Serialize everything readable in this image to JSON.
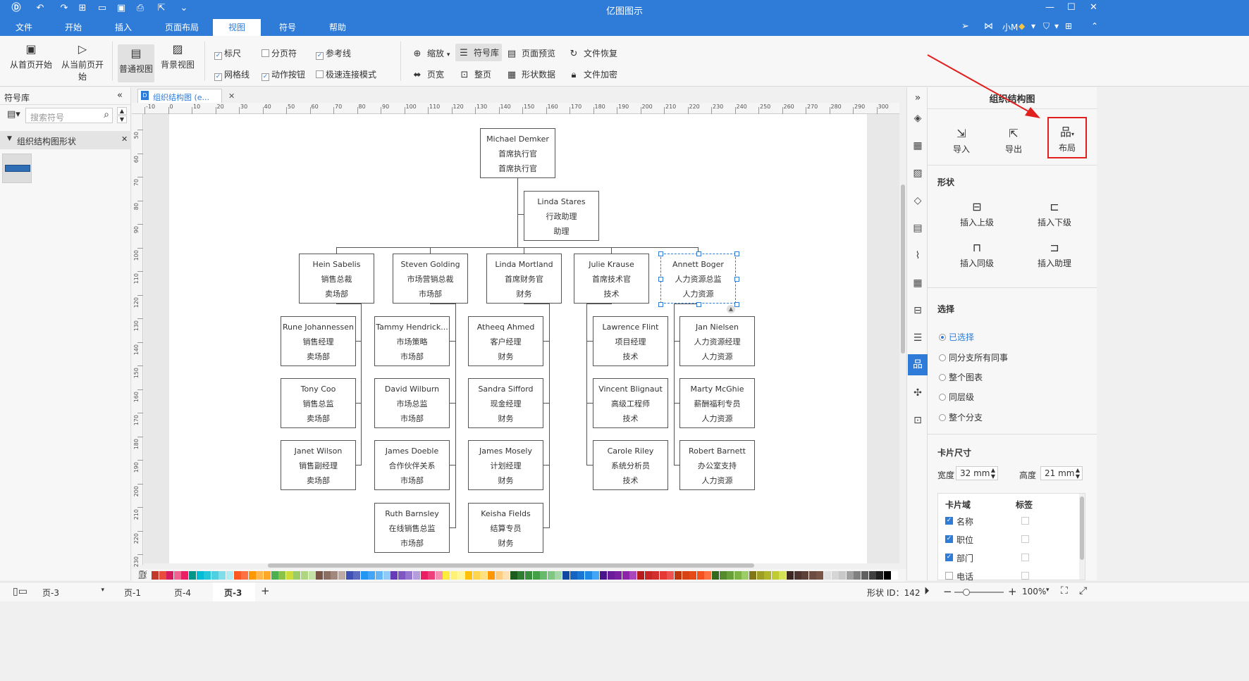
{
  "titlebar": {
    "title": "亿图图示",
    "user": "小M",
    "quick_icons": [
      "logo-icon",
      "undo-icon",
      "redo-icon",
      "new-icon",
      "open-icon",
      "save-icon",
      "print-icon",
      "export-icon",
      "more-icon"
    ]
  },
  "menu": [
    "文件",
    "开始",
    "插入",
    "页面布局",
    "视图",
    "符号",
    "帮助"
  ],
  "menu_active": "视图",
  "ribbon": {
    "big": [
      "从首页开始",
      "从当前页开始",
      "普通视图",
      "背景视图"
    ],
    "checks": [
      {
        "label": "标尺",
        "checked": true
      },
      {
        "label": "分页符",
        "checked": false
      },
      {
        "label": "参考线",
        "checked": true
      },
      {
        "label": "网格线",
        "checked": true
      },
      {
        "label": "动作按钮",
        "checked": true
      },
      {
        "label": "极速连接模式",
        "checked": false
      }
    ],
    "small": [
      "缩放",
      "符号库",
      "页面预览",
      "文件恢复",
      "页宽",
      "整页",
      "形状数据",
      "文件加密"
    ]
  },
  "left": {
    "title": "符号库",
    "search_placeholder": "搜索符号",
    "library": "组织结构图形状"
  },
  "tab": {
    "label": "组织结构图 (e..."
  },
  "ruler_h": [
    "-10",
    "0",
    "10",
    "20",
    "30",
    "40",
    "50",
    "60",
    "70",
    "80",
    "90",
    "100",
    "110",
    "120",
    "130",
    "140",
    "150",
    "160",
    "170",
    "180",
    "190",
    "200",
    "210",
    "220",
    "230",
    "240",
    "250",
    "260",
    "270",
    "280",
    "290",
    "300"
  ],
  "ruler_v": [
    "50",
    "60",
    "70",
    "80",
    "90",
    "100",
    "110",
    "120",
    "130",
    "140",
    "150",
    "160",
    "170",
    "180",
    "190",
    "200",
    "210",
    "220",
    "230"
  ],
  "org": {
    "root": {
      "name": "Michael Demker",
      "title": "首席执行官",
      "dept": "首席执行官"
    },
    "assistant": {
      "name": "Linda Stares",
      "title": "行政助理",
      "dept": "助理"
    },
    "heads": [
      {
        "name": "Hein Sabelis",
        "title": "销售总裁",
        "dept": "卖场部"
      },
      {
        "name": "Steven Golding",
        "title": "市场营销总裁",
        "dept": "市场部"
      },
      {
        "name": "Linda Mortland",
        "title": "首席财务官",
        "dept": "财务"
      },
      {
        "name": "Julie Krause",
        "title": "首席技术官",
        "dept": "技术"
      },
      {
        "name": "Annett Boger",
        "title": "人力资源总监",
        "dept": "人力资源"
      }
    ],
    "col1": [
      {
        "name": "Rune Johannessen",
        "title": "销售经理",
        "dept": "卖场部"
      },
      {
        "name": "Tony Coo",
        "title": "销售总监",
        "dept": "卖场部"
      },
      {
        "name": "Janet Wilson",
        "title": "销售副经理",
        "dept": "卖场部"
      }
    ],
    "col2": [
      {
        "name": "Tammy Hendrick...",
        "title": "市场策略",
        "dept": "市场部"
      },
      {
        "name": "David Wilburn",
        "title": "市场总监",
        "dept": "市场部"
      },
      {
        "name": "James Doeble",
        "title": "合作伙伴关系",
        "dept": "市场部"
      },
      {
        "name": "Ruth Barnsley",
        "title": "在线销售总监",
        "dept": "市场部"
      }
    ],
    "col3": [
      {
        "name": "Atheeq Ahmed",
        "title": "客户经理",
        "dept": "财务"
      },
      {
        "name": "Sandra Sifford",
        "title": "现金经理",
        "dept": "财务"
      },
      {
        "name": "James Mosely",
        "title": "计划经理",
        "dept": "财务"
      },
      {
        "name": "Keisha Fields",
        "title": "结算专员",
        "dept": "财务"
      }
    ],
    "col4": [
      {
        "name": "Lawrence Flint",
        "title": "项目经理",
        "dept": "技术"
      },
      {
        "name": "Vincent Blignaut",
        "title": "高级工程师",
        "dept": "技术"
      },
      {
        "name": "Carole Riley",
        "title": "系统分析员",
        "dept": "技术"
      }
    ],
    "col5": [
      {
        "name": "Jan Nielsen",
        "title": "人力资源经理",
        "dept": "人力资源"
      },
      {
        "name": "Marty McGhie",
        "title": "薪酬福利专员",
        "dept": "人力资源"
      },
      {
        "name": "Robert Barnett",
        "title": "办公室支持",
        "dept": "人力资源"
      }
    ]
  },
  "right": {
    "title": "组织结构图",
    "buttons": [
      "导入",
      "导出",
      "布局"
    ],
    "shape_section": "形状",
    "shape_buttons": [
      "插入上级",
      "插入下级",
      "插入同级",
      "插入助理"
    ],
    "select_section": "选择",
    "select_options": [
      "已选择",
      "同分支所有同事",
      "整个图表",
      "同层级",
      "整个分支"
    ],
    "card_size_section": "卡片尺寸",
    "width_label": "宽度",
    "width_value": "32 mm",
    "height_label": "高度",
    "height_value": "21 mm",
    "field_header": "卡片域",
    "label_header": "标签",
    "fields": [
      {
        "name": "名称",
        "checked": true
      },
      {
        "name": "职位",
        "checked": true
      },
      {
        "name": "部门",
        "checked": true
      },
      {
        "name": "电话",
        "checked": false
      }
    ]
  },
  "status": {
    "page_select": "页-3",
    "pages": [
      "页-1",
      "页-4",
      "页-3"
    ],
    "add": "+",
    "shape_id": "形状 ID：142",
    "zoom": "100%"
  },
  "colors": {
    "accent": "#2f7bd8",
    "annotation_red": "#e0201f",
    "palette": [
      "#c0392b",
      "#e74c3c",
      "#d81b60",
      "#f06292",
      "#e91e63",
      "#009688",
      "#00bcd4",
      "#26c6da",
      "#4dd0e1",
      "#80deea",
      "#b2ebf2",
      "#ff5722",
      "#ff7043",
      "#ff9800",
      "#ffb74d",
      "#ffa726",
      "#4caf50",
      "#8bc34a",
      "#cddc39",
      "#9ccc65",
      "#aed581",
      "#c5e1a5",
      "#795548",
      "#8d6e63",
      "#a1887f",
      "#bcaaa4",
      "#3f51b5",
      "#5c6bc0",
      "#2196f3",
      "#42a5f5",
      "#64b5f6",
      "#90caf9",
      "#673ab7",
      "#7e57c2",
      "#9575cd",
      "#b39ddb",
      "#e91e63",
      "#ec407a",
      "#f48fb1",
      "#ffeb3b",
      "#fff176",
      "#fff59d",
      "#ffc107",
      "#ffd54f",
      "#ffe082",
      "#ff9800",
      "#ffcc80",
      "#ffe0b2",
      "#1b5e20",
      "#2e7d32",
      "#388e3c",
      "#43a047",
      "#66bb6a",
      "#81c784",
      "#a5d6a7",
      "#0d47a1",
      "#1565c0",
      "#1976d2",
      "#1e88e5",
      "#42a5f5",
      "#4a148c",
      "#6a1b9a",
      "#7b1fa2",
      "#8e24aa",
      "#ab47bc",
      "#b71c1c",
      "#c62828",
      "#d32f2f",
      "#e53935",
      "#ef5350",
      "#bf360c",
      "#d84315",
      "#e64a19",
      "#f4511e",
      "#ff7043",
      "#33691e",
      "#558b2f",
      "#689f38",
      "#7cb342",
      "#9ccc65",
      "#827717",
      "#9e9d24",
      "#afb42b",
      "#c0ca33",
      "#d4e157",
      "#3e2723",
      "#4e342e",
      "#5d4037",
      "#6d4c41",
      "#795548",
      "#e0e0e0",
      "#d6d6d6",
      "#c8c8c8",
      "#a0a0a0",
      "#808080",
      "#606060",
      "#404040",
      "#202020",
      "#000000",
      "#ffffff"
    ]
  }
}
